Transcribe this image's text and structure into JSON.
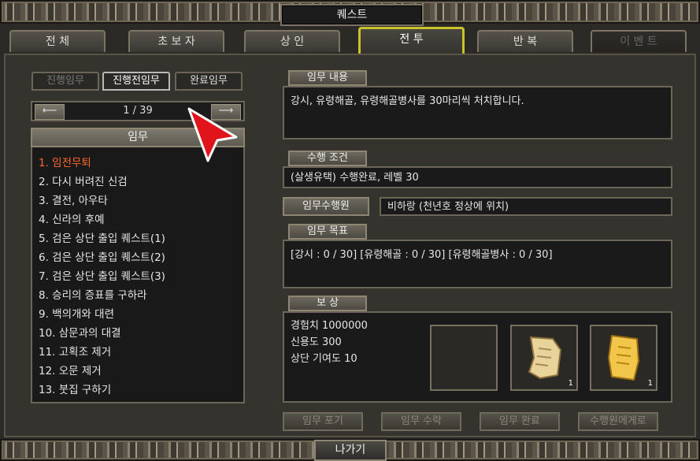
{
  "window": {
    "title": "퀘스트",
    "exit_label": "나가기"
  },
  "tabs": [
    {
      "label": "전    체"
    },
    {
      "label": "초 보 자"
    },
    {
      "label": "상    인"
    },
    {
      "label": "전    투"
    },
    {
      "label": "반    복"
    },
    {
      "label": "이 벤 트"
    }
  ],
  "subtabs": [
    {
      "label": "진행임무"
    },
    {
      "label": "진행전임무"
    },
    {
      "label": "완료임무"
    }
  ],
  "pager": {
    "text": "1 / 39"
  },
  "list": {
    "header": "임무",
    "items": [
      "1. 임전무퇴",
      "2. 다시 버려진 신검",
      "3. 결전, 아우타",
      "4. 신라의 후예",
      "5. 검은 상단 출입 퀘스트(1)",
      "6. 검은 상단 출입 퀘스트(2)",
      "7. 검은 상단 출입 퀘스트(3)",
      "8. 승리의 증표를 구하라",
      "9. 백의개와 대련",
      "10. 삼문과의 대결",
      "11. 고획조 제거",
      "12. 오문 제거",
      "13. 붓집 구하기"
    ]
  },
  "detail": {
    "content_label": "임무 내용",
    "content_text": "강시, 유령해골, 유령해골병사를 30마리씩 처치합니다.",
    "condition_label": "수행 조건",
    "condition_text": "(살생유택) 수행완료, 레벨 30",
    "npc_label": "임무수행원",
    "npc_text": "비하랑 (천년호 정상에 위치)",
    "goal_label": "임무 목표",
    "goal_text": "[강시 : 0 / 30] [유령해골 : 0 / 30] [유령해골병사 : 0 / 30]",
    "reward_label": "보      상",
    "rewards": [
      "경험치 1000000",
      "신용도 300",
      "상단 기여도 10"
    ],
    "reward_slots": [
      {
        "icon": "empty-slot",
        "count": ""
      },
      {
        "icon": "scroll-icon",
        "count": "1"
      },
      {
        "icon": "golden-scroll-icon",
        "count": "1"
      }
    ]
  },
  "actions": {
    "give_up": "임무 포기",
    "accept": "임무 수락",
    "complete": "임무 완료",
    "to_npc": "수행원에게로"
  },
  "colors": {
    "active_tab_border": "#c8c22b",
    "selected_item": "#ff6a2a"
  }
}
